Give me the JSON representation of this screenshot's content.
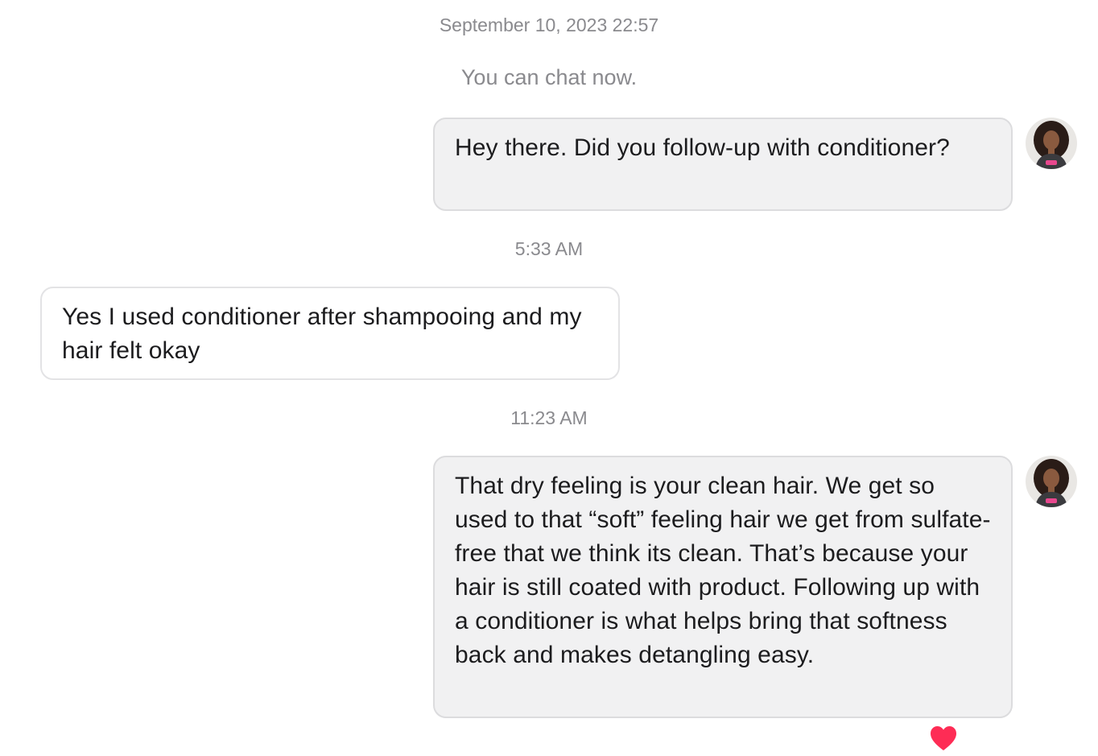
{
  "thread": {
    "date_header": "September 10, 2023 22:57",
    "system_note": "You can chat now."
  },
  "messages": [
    {
      "direction": "outgoing",
      "text": "Hey there. Did you follow-up with conditioner?"
    },
    {
      "timestamp": "5:33 AM",
      "direction": "incoming",
      "text": "Yes I used conditioner after shampooing and my hair felt okay"
    },
    {
      "timestamp": "11:23 AM",
      "direction": "outgoing",
      "text": "That dry feeling is your clean hair. We get so used to that “soft” feeling hair we get from sulfate-free that we think its clean. That’s because your hair is still coated with product. Following up with a conditioner is what helps bring that softness back and makes detangling easy.",
      "reaction": "heart-icon"
    }
  ],
  "colors": {
    "outgoing_bubble": "#f1f1f2",
    "incoming_bubble": "#ffffff",
    "timestamp_text": "#8a8a8e",
    "reaction_heart": "#fe2c55"
  }
}
